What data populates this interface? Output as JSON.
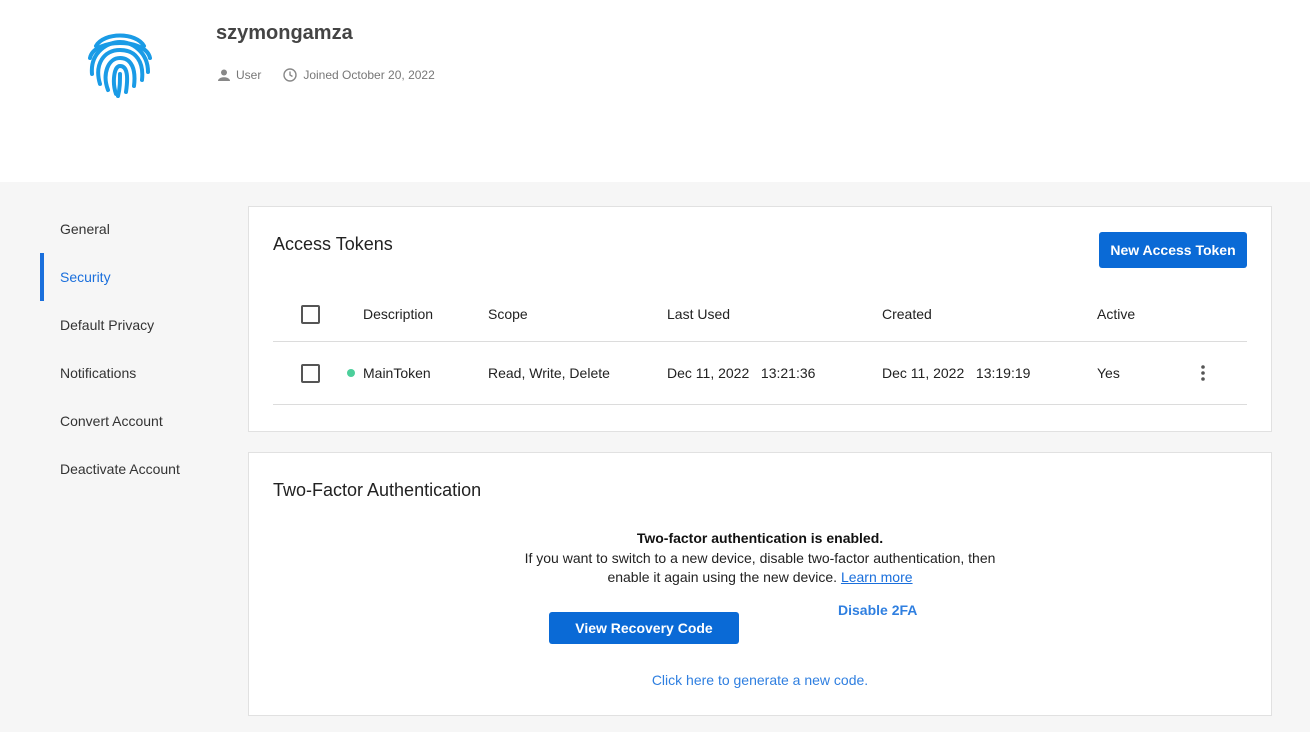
{
  "profile": {
    "username": "szymongamza",
    "role": "User",
    "joined": "Joined October 20, 2022",
    "avatar_icon": "fingerprint-icon",
    "avatar_color": "#1a9be6"
  },
  "sidebar": {
    "items": [
      {
        "label": "General"
      },
      {
        "label": "Security",
        "active": true
      },
      {
        "label": "Default Privacy"
      },
      {
        "label": "Notifications"
      },
      {
        "label": "Convert Account"
      },
      {
        "label": "Deactivate Account"
      }
    ]
  },
  "access_tokens": {
    "title": "Access Tokens",
    "new_button": "New Access Token",
    "columns": [
      "Description",
      "Scope",
      "Last Used",
      "Created",
      "Active"
    ],
    "rows": [
      {
        "description": "MainToken",
        "scope": "Read, Write, Delete",
        "last_used": "Dec 11, 2022   13:21:36",
        "created": "Dec 11, 2022   13:19:19",
        "active": "Yes",
        "status_color": "#4ccf9b"
      }
    ]
  },
  "two_factor": {
    "title": "Two-Factor Authentication",
    "status": "Two-factor authentication is enabled.",
    "description_line1": "If you want to switch to a new device, disable two-factor authentication, then",
    "description_line2": "enable it again using the new device.",
    "learn_more": "Learn more",
    "disable_label": "Disable 2FA",
    "recovery_button": "View Recovery Code",
    "generate_link": "Click here to generate a new code."
  },
  "colors": {
    "accent": "#0a6ad6",
    "link": "#2f7fe0",
    "background": "#f6f6f6"
  }
}
